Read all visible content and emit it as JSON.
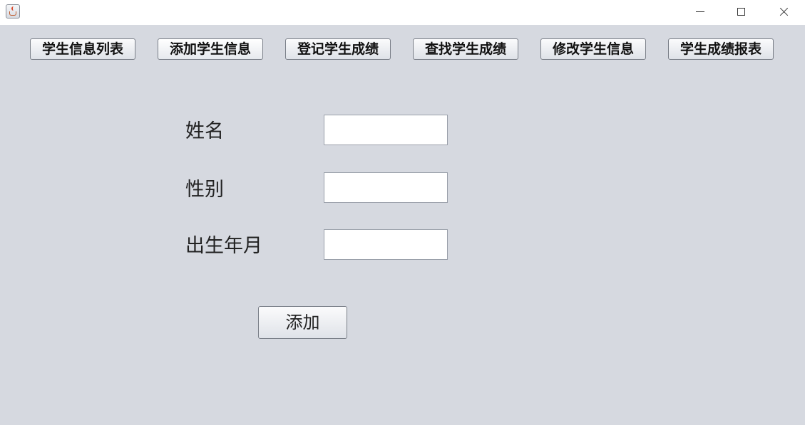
{
  "window": {
    "title": "",
    "controls": {
      "minimize_icon": "minimize-icon",
      "maximize_icon": "maximize-icon",
      "close_icon": "close-icon"
    }
  },
  "toolbar": {
    "buttons": [
      {
        "label": "学生信息列表"
      },
      {
        "label": "添加学生信息"
      },
      {
        "label": "登记学生成绩"
      },
      {
        "label": "查找学生成绩"
      },
      {
        "label": "修改学生信息"
      },
      {
        "label": "学生成绩报表"
      }
    ]
  },
  "form": {
    "name": {
      "label": "姓名",
      "value": ""
    },
    "gender": {
      "label": "性别",
      "value": ""
    },
    "birth": {
      "label": "出生年月",
      "value": ""
    },
    "submit_label": "添加"
  },
  "colors": {
    "background": "#d6d9e0",
    "titlebar": "#ffffff"
  }
}
